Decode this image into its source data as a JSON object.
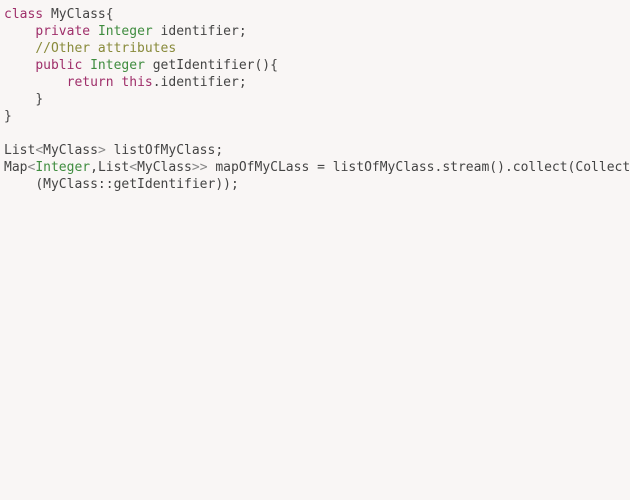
{
  "code": {
    "l1": {
      "kw_class": "class",
      "name": " MyClass{"
    },
    "l2": {
      "indent": "    ",
      "kw_priv": "private",
      "sp": " ",
      "type": "Integer",
      "rest": " identifier;"
    },
    "l3": {
      "indent": "    ",
      "comment": "//Other attributes"
    },
    "l4": {
      "indent": "    ",
      "kw_pub": "public",
      "sp": " ",
      "type": "Integer",
      "rest": " getIdentifier(){"
    },
    "l5": {
      "indent": "        ",
      "kw_ret": "return",
      "sp": " ",
      "kw_this": "this",
      "rest": ".identifier;"
    },
    "l6": {
      "indent": "    ",
      "brace": "}"
    },
    "l7": {
      "brace": "}"
    },
    "l8": {
      "blank": ""
    },
    "l9": {
      "a": "List",
      "lt": "<",
      "b": "MyClass",
      "gt": ">",
      "rest": " listOfMyClass;"
    },
    "l10": {
      "a": "Map",
      "lt1": "<",
      "type": "Integer",
      "comma": ",",
      "b": "List",
      "lt2": "<",
      "c": "MyClass",
      "gtgt": ">>",
      "rest": " mapOfMyCLass = listOfMyClass.stream().collect(Collect"
    },
    "l11": {
      "indent": "    ",
      "rest": "(MyClass::getIdentifier));"
    }
  }
}
